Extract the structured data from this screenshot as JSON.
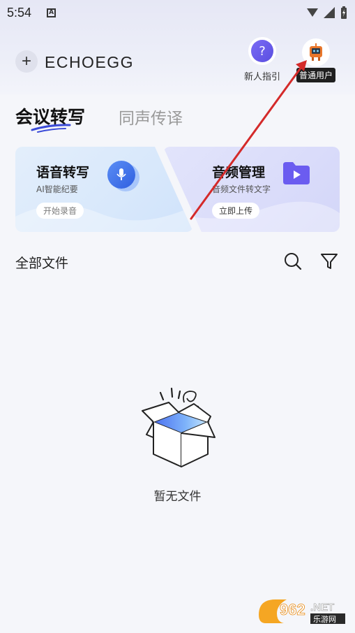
{
  "status_bar": {
    "time": "5:54",
    "notification_letter": "A"
  },
  "header": {
    "brand": "ECHOEGG",
    "guide_label": "新人指引",
    "user_badge": "普通用户"
  },
  "tabs": [
    {
      "label": "会议转写",
      "active": true
    },
    {
      "label": "同声传译",
      "active": false
    }
  ],
  "cards": [
    {
      "title": "语音转写",
      "subtitle": "AI智能纪要",
      "button": "开始录音",
      "icon": "microphone-icon"
    },
    {
      "title": "音频管理",
      "subtitle": "音频文件转文字",
      "button": "立即上传",
      "icon": "video-folder-icon"
    }
  ],
  "files": {
    "title": "全部文件",
    "empty_label": "暂无文件",
    "icons": [
      "search-icon",
      "filter-icon"
    ]
  },
  "watermark": {
    "number": "962",
    "suffix": ".NET",
    "site": "乐游网"
  },
  "colors": {
    "accent": "#5a4ee0",
    "arrow": "#d42a2a"
  }
}
